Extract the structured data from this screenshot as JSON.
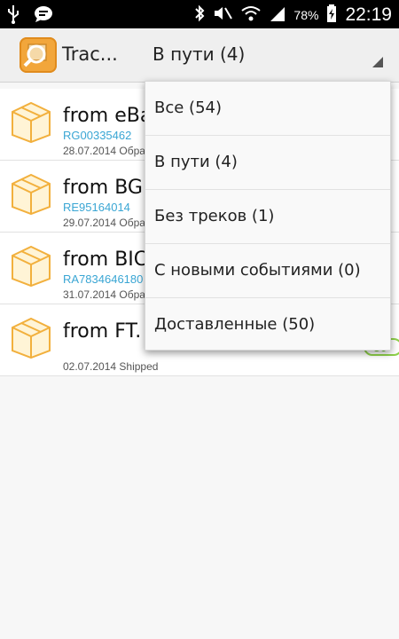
{
  "status_bar": {
    "battery_percent": "78%",
    "time": "22:19",
    "left_icons": [
      "usb-icon",
      "message-icon"
    ],
    "right_icons": [
      "bluetooth-icon",
      "mute-icon",
      "wifi-icon",
      "signal-icon",
      "battery-charging-icon"
    ]
  },
  "action_bar": {
    "app_title": "Trac...",
    "filter_selected": "В пути (4)"
  },
  "parcels": [
    {
      "sender": "from eBa",
      "track": "RG00335462",
      "date_status": "28.07.2014 Обра"
    },
    {
      "sender": "from BG.",
      "track": "RE95164014",
      "date_status": "29.07.2014 Обра"
    },
    {
      "sender": "from BIC",
      "track": "RA7834646180",
      "date_status": "31.07.2014 Обра"
    },
    {
      "sender": "from FT.",
      "track": "",
      "date_status": "02.07.2014 Shipped",
      "days": "30"
    }
  ],
  "dropdown": {
    "options": [
      "Все (54)",
      "В пути (4)",
      "Без треков (1)",
      "С новыми событиями (0)",
      "Доставленные (50)"
    ]
  },
  "colors": {
    "accent_orange": "#f2a63b",
    "track_blue": "#3aa6d4",
    "badge_green": "#8fd24a"
  }
}
